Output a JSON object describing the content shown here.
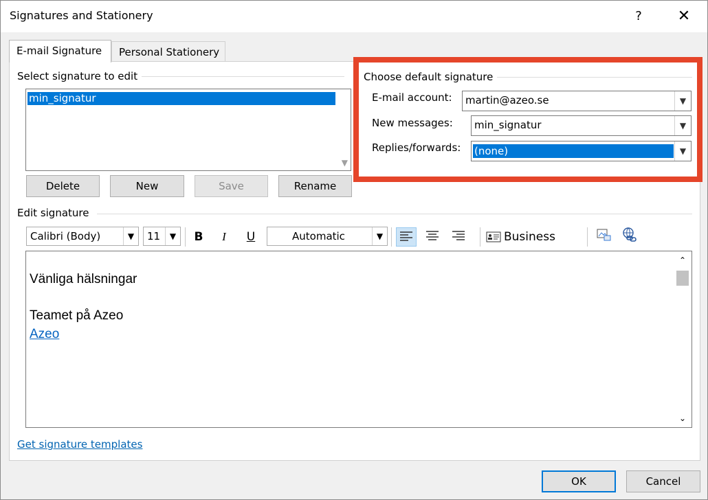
{
  "window": {
    "title": "Signatures and Stationery",
    "help": "?",
    "close": "✕"
  },
  "tabs": [
    {
      "label": "E-mail Signature",
      "active": true
    },
    {
      "label": "Personal Stationery",
      "active": false
    }
  ],
  "select_signature": {
    "label": "Select signature to edit",
    "items": [
      "min_signatur"
    ],
    "selected": "min_signatur"
  },
  "signature_buttons": {
    "delete": "Delete",
    "new": "New",
    "save": "Save",
    "rename": "Rename"
  },
  "default_signature": {
    "label": "Choose default signature",
    "email_account_label": "E-mail account:",
    "email_account_value": "martin@azeo.se",
    "new_messages_label": "New messages:",
    "new_messages_value": "min_signatur",
    "replies_label": "Replies/forwards:",
    "replies_value": "(none)"
  },
  "edit_signature": {
    "label": "Edit signature",
    "font": "Calibri (Body)",
    "size": "11",
    "bold": "B",
    "italic": "I",
    "underline": "U",
    "color": "Automatic",
    "business_card": "Business Card",
    "content": [
      "Vänliga hälsningar",
      "Teamet på Azeo",
      "Azeo"
    ]
  },
  "templates_link": "Get signature templates",
  "footer": {
    "ok": "OK",
    "cancel": "Cancel"
  },
  "colors": {
    "accent": "#0078d7",
    "highlight": "#e5452a",
    "link": "#0563c1"
  }
}
